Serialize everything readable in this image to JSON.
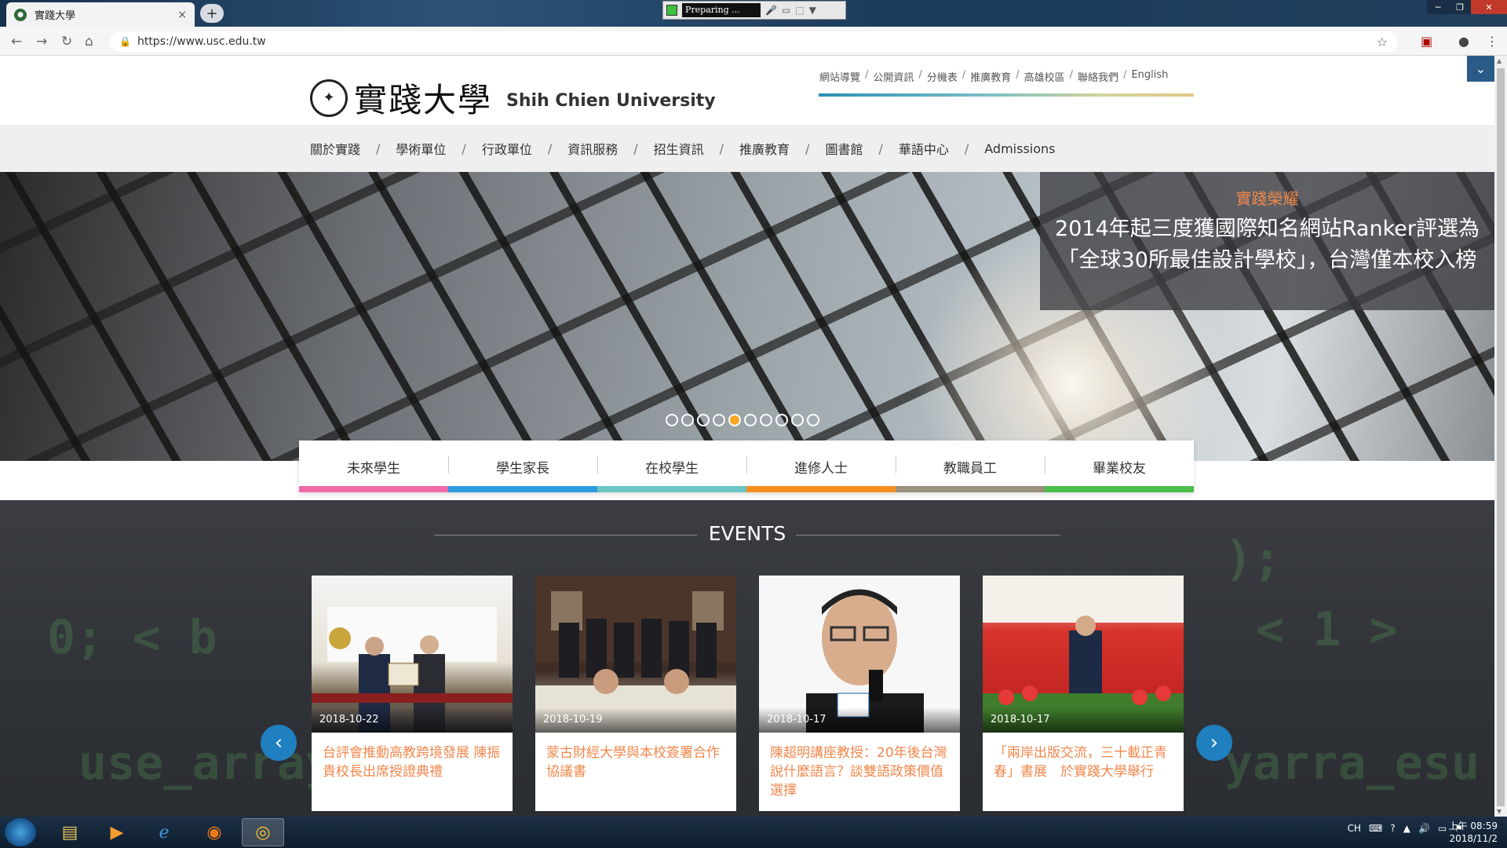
{
  "browser": {
    "tab_title": "實踐大學",
    "tab_close": "×",
    "new_tab": "+",
    "url": "https://www.usc.edu.tw",
    "recorder_status": "Preparing ..."
  },
  "site": {
    "logo_cn": "實踐大學",
    "logo_en": "Shih Chien University",
    "top_links": [
      "網站導覽",
      "公開資訊",
      "分機表",
      "推廣教育",
      "高雄校區",
      "聯絡我們",
      "English"
    ],
    "main_nav": [
      "關於實踐",
      "學術單位",
      "行政單位",
      "資訊服務",
      "招生資訊",
      "推廣教育",
      "圖書館",
      "華語中心",
      "Admissions"
    ]
  },
  "hero": {
    "kicker": "實踐榮耀",
    "headline": "2014年起三度獲國際知名網站Ranker評選為「全球30所最佳設計學校」，台灣僅本校入榜",
    "slide_count": 10,
    "active_slide": 5
  },
  "audience": [
    {
      "label": "未來學生",
      "color": "#f06aa8"
    },
    {
      "label": "學生家長",
      "color": "#2f9be0"
    },
    {
      "label": "在校學生",
      "color": "#6cc4c4"
    },
    {
      "label": "進修人士",
      "color": "#f5901e"
    },
    {
      "label": "教職員工",
      "color": "#9b8f7e"
    },
    {
      "label": "畢業校友",
      "color": "#4cbf4c"
    }
  ],
  "events": {
    "title": "EVENTS",
    "items": [
      {
        "date": "2018-10-22",
        "text": "台評會推動高教跨境發展 陳振貴校長出席授證典禮"
      },
      {
        "date": "2018-10-19",
        "text": "蒙古財經大學與本校簽署合作協議書"
      },
      {
        "date": "2018-10-17",
        "text": "陳超明講座教授：20年後台灣說什麼語言？談雙語政策價值選擇"
      },
      {
        "date": "2018-10-17",
        "text": "「兩岸出版交流，三十載正青春」書展　於實踐大學舉行"
      }
    ]
  },
  "taskbar": {
    "lang": "CH",
    "time": "上午 08:59",
    "date": "2018/11/2"
  }
}
